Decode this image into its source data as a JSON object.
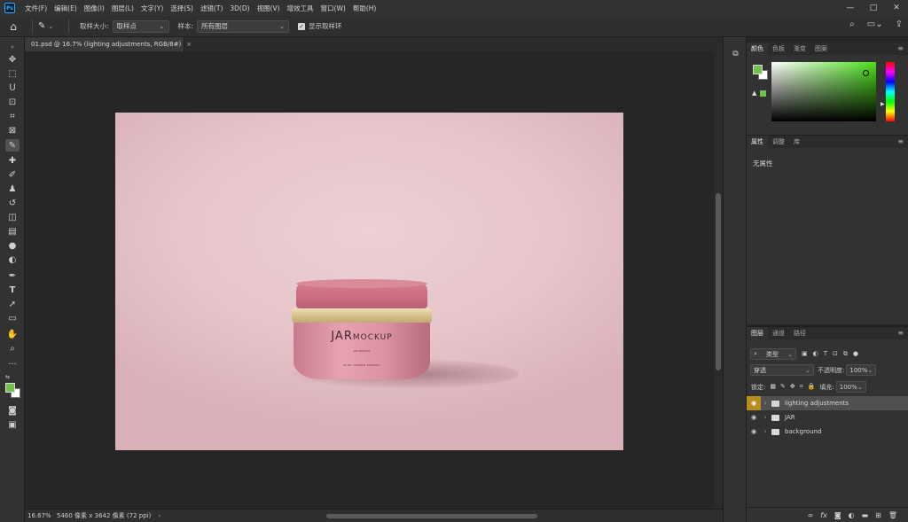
{
  "app": {
    "logo": "Ps",
    "menu": [
      "文件(F)",
      "编辑(E)",
      "图像(I)",
      "图层(L)",
      "文字(Y)",
      "选择(S)",
      "滤镜(T)",
      "3D(D)",
      "视图(V)",
      "增效工具",
      "窗口(W)",
      "帮助(H)"
    ],
    "window_controls": [
      "—",
      "□",
      "✕"
    ]
  },
  "options": {
    "sample_size_label": "取样大小:",
    "sample_size_value": "取样点",
    "sample_label": "样本:",
    "sample_value": "所有图层",
    "show_ring_label": "显示取样环",
    "show_ring_checked": true
  },
  "document": {
    "tab_title": "01.psd @ 16.7% (lighting adjustments, RGB/8#)",
    "close_glyph": "×"
  },
  "artwork": {
    "logo_main": "JAR",
    "logo_sub": "MOCKUP",
    "small_line": "JAR MOCKUP",
    "tiny_line": "50 ML · NATURAL FORMULA"
  },
  "status": {
    "zoom": "16.67%",
    "doc_info": "5460 像素 x 3642 像素 (72 ppi)",
    "arrow": "›"
  },
  "color_panel": {
    "tabs": [
      "颜色",
      "色板",
      "渐变",
      "图案"
    ],
    "foreground": "#6fc34a",
    "background": "#ffffff"
  },
  "properties_panel": {
    "tabs": [
      "属性",
      "调整",
      "库"
    ],
    "empty_text": "无属性"
  },
  "layers_panel": {
    "tabs": [
      "图层",
      "通道",
      "路径"
    ],
    "filter_kind": "类型",
    "blend_mode": "穿透",
    "opacity_label": "不透明度:",
    "opacity_value": "100%",
    "lock_label": "锁定:",
    "fill_label": "填充:",
    "fill_value": "100%",
    "layers": [
      {
        "name": "lighting adjustments",
        "type": "group",
        "visible": true,
        "selected": true
      },
      {
        "name": "JAR",
        "type": "group",
        "visible": true,
        "selected": false
      },
      {
        "name": "background",
        "type": "group",
        "visible": true,
        "selected": false
      }
    ]
  },
  "colors": {
    "selection_eye": "#b98e1e",
    "accent_blue": "#31a8ff"
  }
}
